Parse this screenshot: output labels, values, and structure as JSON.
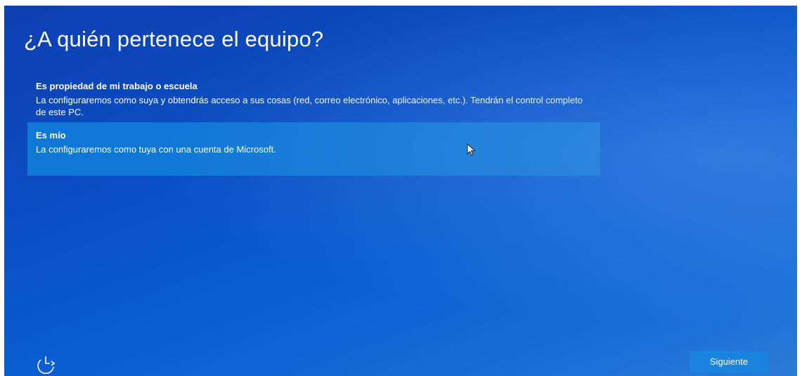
{
  "page": {
    "title": "¿A quién pertenece el equipo?"
  },
  "options": [
    {
      "title": "Es propiedad de mi trabajo o escuela",
      "description": "La configuraremos como suya y obtendrás acceso a sus cosas (red, correo electrónico, aplicaciones, etc.). Tendrán el control completo de este PC.",
      "selected": false
    },
    {
      "title": "Es mío",
      "description": "La configuraremos como tuya con una cuenta de Microsoft.",
      "selected": true
    }
  ],
  "footer": {
    "next_label": "Siguiente",
    "accessibility_icon": "ease-of-access-icon"
  },
  "colors": {
    "background": "#0b4fc6",
    "selected_option": "#0f78d6",
    "next_button": "#1a83dd",
    "text": "#ffffff"
  }
}
